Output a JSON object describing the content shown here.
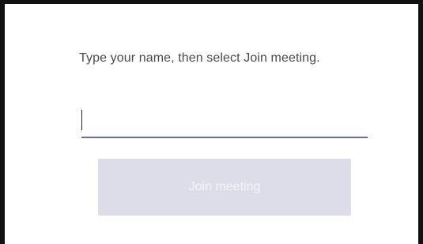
{
  "prompt": {
    "instruction": "Type your name, then select Join meeting."
  },
  "name_field": {
    "value": "",
    "placeholder": ""
  },
  "join_button": {
    "label": "Join meeting",
    "enabled": false
  },
  "colors": {
    "underline_accent": "#6b67b5",
    "button_disabled_bg": "#dddde9",
    "button_disabled_text": "#f4f4f8",
    "instruction_text": "#4a4a4a"
  }
}
